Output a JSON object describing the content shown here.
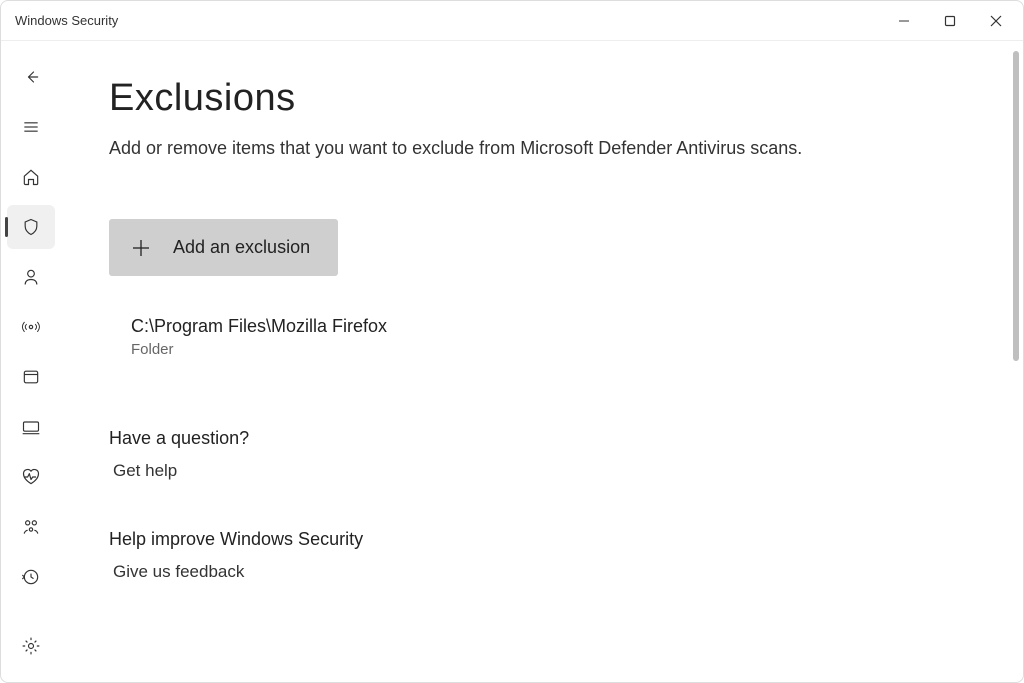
{
  "window": {
    "title": "Windows Security"
  },
  "page": {
    "title": "Exclusions",
    "subtitle": "Add or remove items that you want to exclude from Microsoft Defender Antivirus scans."
  },
  "actions": {
    "add_label": "Add an exclusion"
  },
  "exclusions": [
    {
      "path": "C:\\Program Files\\Mozilla Firefox",
      "type": "Folder"
    }
  ],
  "help": {
    "question_heading": "Have a question?",
    "get_help": "Get help",
    "improve_heading": "Help improve Windows Security",
    "feedback": "Give us feedback"
  }
}
